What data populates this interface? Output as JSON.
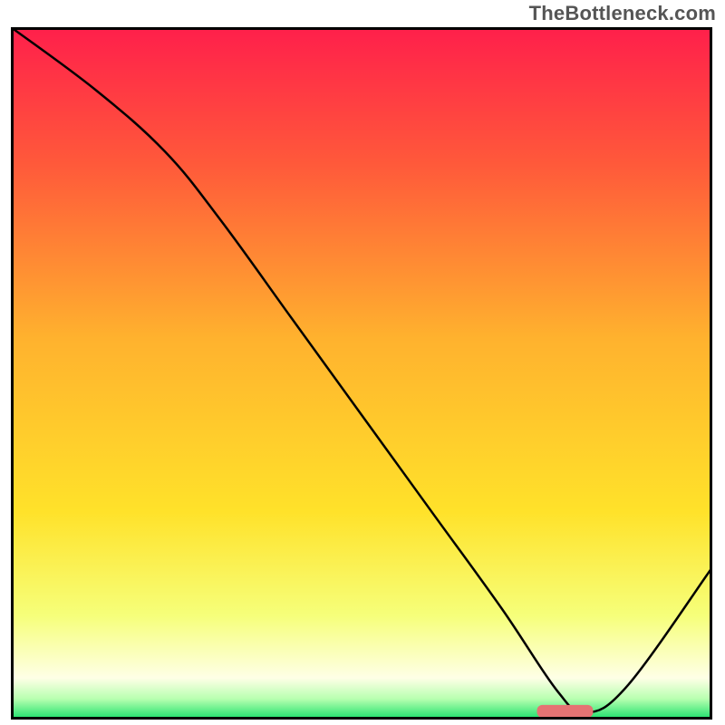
{
  "attribution": "TheBottleneck.com",
  "chart_data": {
    "type": "line",
    "title": "",
    "xlabel": "",
    "ylabel": "",
    "xlim": [
      0,
      100
    ],
    "ylim": [
      0,
      100
    ],
    "grid": false,
    "legend": false,
    "gradient_stops": [
      {
        "offset": 0.0,
        "color": "#ff1f4b"
      },
      {
        "offset": 0.2,
        "color": "#ff5a3a"
      },
      {
        "offset": 0.45,
        "color": "#ffb22e"
      },
      {
        "offset": 0.7,
        "color": "#ffe22a"
      },
      {
        "offset": 0.85,
        "color": "#f6ff7a"
      },
      {
        "offset": 0.94,
        "color": "#feffe6"
      },
      {
        "offset": 0.97,
        "color": "#b8ffb0"
      },
      {
        "offset": 1.0,
        "color": "#18e06a"
      }
    ],
    "series": [
      {
        "name": "bottleneck-curve",
        "x": [
          0,
          12,
          22,
          30,
          40,
          50,
          60,
          70,
          78,
          82,
          88,
          100
        ],
        "values": [
          100,
          91,
          82,
          72,
          58,
          44,
          30,
          16,
          4,
          1,
          5,
          22
        ]
      }
    ],
    "marker": {
      "name": "ideal-zone",
      "x_range": [
        75,
        83
      ],
      "y": 1.2,
      "color": "#e57373"
    },
    "frame_color": "#000000",
    "curve_stroke": "#000000",
    "curve_width": 2.5
  }
}
